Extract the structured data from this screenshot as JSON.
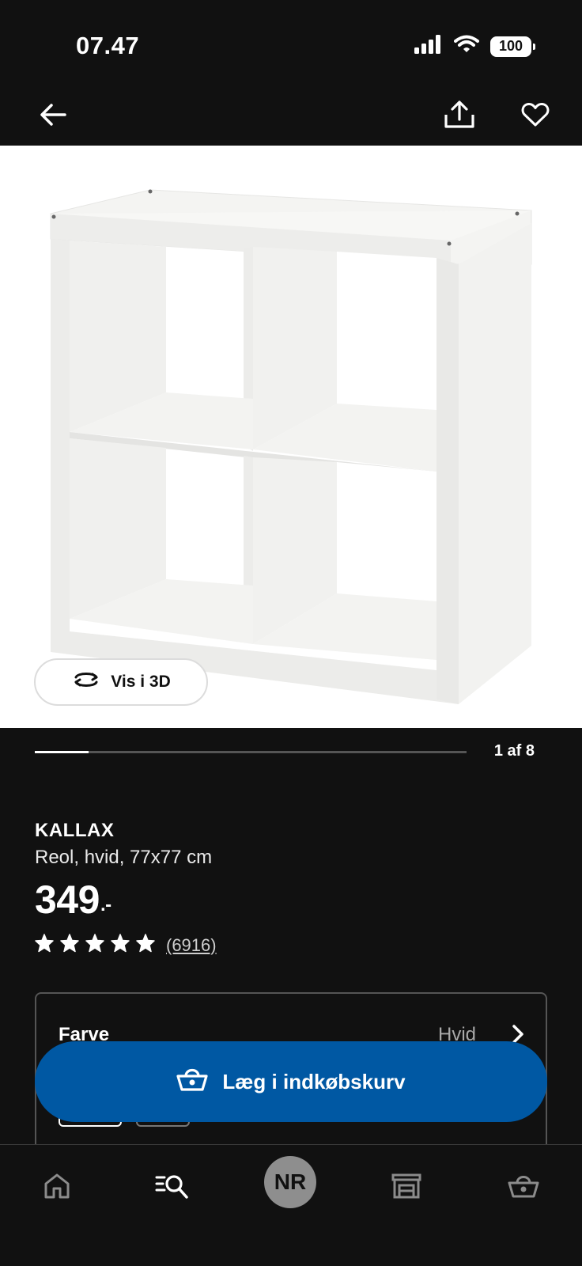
{
  "status_bar": {
    "time": "07.47",
    "battery": "100",
    "icons": [
      "signal-icon",
      "wifi-icon",
      "battery-icon"
    ]
  },
  "top_nav": {
    "icons": [
      "arrow-left-icon",
      "share-icon",
      "heart-icon"
    ]
  },
  "gallery": {
    "vis3d_label": "Vis i 3D",
    "pager_text": "1 af 8",
    "current_image": 1,
    "total_images": 8,
    "progress_fraction": 0.125
  },
  "product": {
    "name": "KALLAX",
    "description": "Reol, hvid, 77x77 cm",
    "price": "349",
    "price_suffix": ".-",
    "rating_stars": 5,
    "review_count": "(6916)"
  },
  "variant": {
    "label": "Farve",
    "value": "Hvid"
  },
  "cart": {
    "label": "Læg i indkøbskurv",
    "color": "#0058a3"
  },
  "tab_bar": {
    "avatar_initials": "NR",
    "tabs": [
      "home-icon",
      "search-list-icon",
      "avatar",
      "store-icon",
      "basket-icon"
    ]
  }
}
